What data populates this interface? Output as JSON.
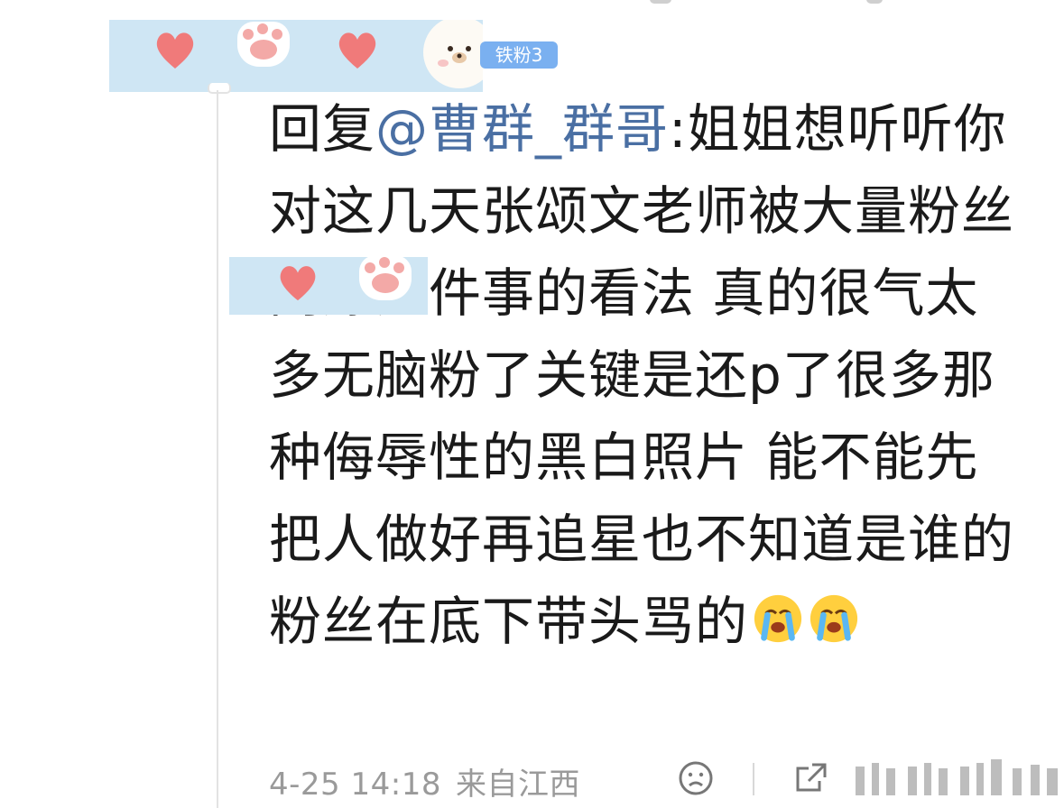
{
  "fan_badge": "铁粉3",
  "comment": {
    "prefix": "回复",
    "mention": "@曹群_群哥",
    "text": ":姐姐想听听你对这几天张颂文老师被大量粉丝网爆这件事的看法 真的很气太多无脑粉了关键是还p了很多那种侮辱性的黑白照片  能不能先把人做好再追星也不知道是谁的粉丝在底下带头骂的",
    "emojis": [
      "crying-emoji",
      "crying-emoji"
    ]
  },
  "meta": {
    "date": "4-25 14:18",
    "location": "来自江西"
  },
  "icons": [
    "face-icon",
    "share-icon",
    "like-icon"
  ],
  "colors": {
    "mention": "#4a6fa3",
    "badge": "#7ab0f0",
    "meta_text": "#9a9a9a",
    "sticker_bg": "#cfe6f4"
  }
}
